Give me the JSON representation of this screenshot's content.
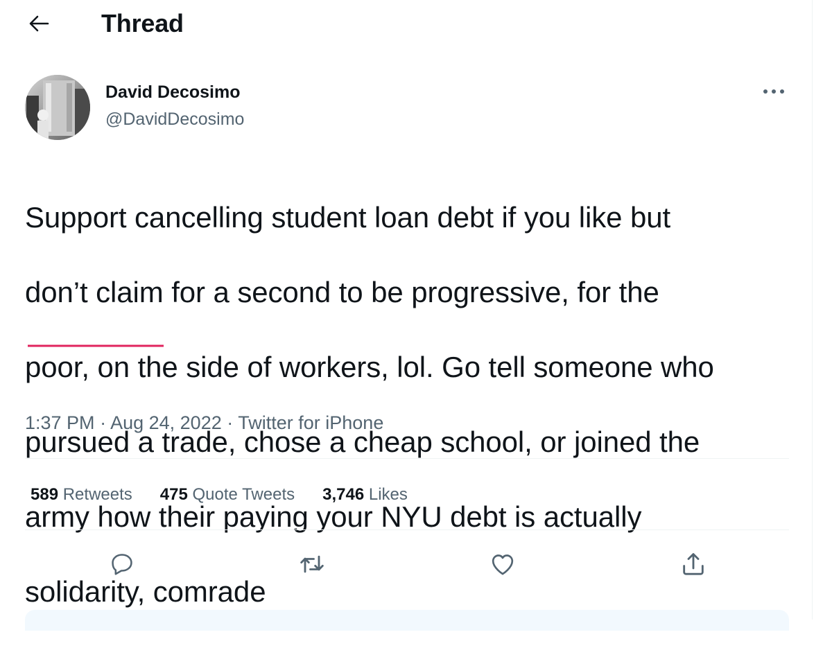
{
  "header": {
    "title": "Thread",
    "back_icon": "arrow-left-icon"
  },
  "tweet": {
    "author": {
      "display_name": "David Decosimo",
      "handle": "@DavidDecosimo"
    },
    "lines": [
      "Support cancelling student loan debt if you like but",
      "don’t claim for a second to be progressive, for the",
      "poor, on the side of workers, lol. Go tell someone who",
      "pursued a trade, chose a cheap school, or joined the",
      "army how their paying your NYU debt is actually",
      "solidarity, comrade"
    ],
    "time": "1:37 PM",
    "date": "Aug 24, 2022",
    "source": "Twitter for iPhone",
    "separator": " · "
  },
  "stats": {
    "retweets": {
      "count": "589",
      "label": "Retweets"
    },
    "quote_tweets": {
      "count": "475",
      "label": "Quote Tweets"
    },
    "likes": {
      "count": "3,746",
      "label": "Likes"
    }
  },
  "actions": {
    "reply_icon": "reply-icon",
    "retweet_icon": "retweet-icon",
    "like_icon": "heart-icon",
    "share_icon": "share-icon"
  },
  "colors": {
    "text": "#0f1419",
    "secondary": "#536471",
    "divider": "#eff3f4",
    "spellcheck": "#e0245e"
  }
}
